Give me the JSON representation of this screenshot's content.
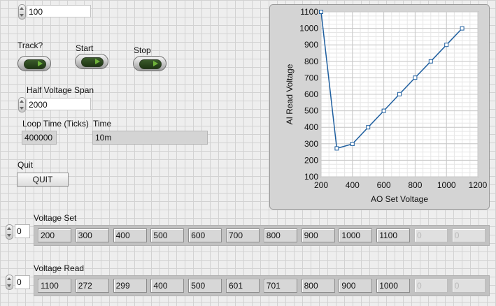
{
  "top_control": {
    "value": "100"
  },
  "buttons": {
    "track_label": "Track?",
    "start_label": "Start",
    "stop_label": "Stop"
  },
  "half_voltage_span": {
    "label": "Half Voltage Span",
    "value": "2000"
  },
  "loop_time": {
    "label": "Loop Time (Ticks)",
    "value": "400000"
  },
  "time": {
    "label": "Time",
    "value": "10m"
  },
  "quit": {
    "label": "Quit",
    "button_text": "QUIT"
  },
  "voltage_set": {
    "label": "Voltage Set",
    "index": "0",
    "values": [
      "200",
      "300",
      "400",
      "500",
      "600",
      "700",
      "800",
      "900",
      "1000",
      "1100",
      "0",
      "0"
    ]
  },
  "voltage_read": {
    "label": "Voltage Read",
    "index": "0",
    "values": [
      "1100",
      "272",
      "299",
      "400",
      "500",
      "601",
      "701",
      "800",
      "900",
      "1000",
      "0",
      "0"
    ]
  },
  "chart_data": {
    "type": "line",
    "title": "",
    "xlabel": "AO Set Voltage",
    "ylabel": "AI Read Voltage",
    "xlim": [
      200,
      1200
    ],
    "ylim": [
      100,
      1100
    ],
    "x_ticks": [
      200,
      400,
      600,
      800,
      1000,
      1200
    ],
    "y_ticks": [
      100,
      200,
      300,
      400,
      500,
      600,
      700,
      800,
      900,
      1000,
      1100
    ],
    "grid": true,
    "line_color": "#1f5f9f",
    "x": [
      200,
      300,
      400,
      500,
      600,
      700,
      800,
      900,
      1000,
      1100
    ],
    "series": [
      {
        "values": [
          1100,
          272,
          299,
          400,
          500,
          601,
          701,
          800,
          900,
          1000
        ]
      }
    ]
  }
}
